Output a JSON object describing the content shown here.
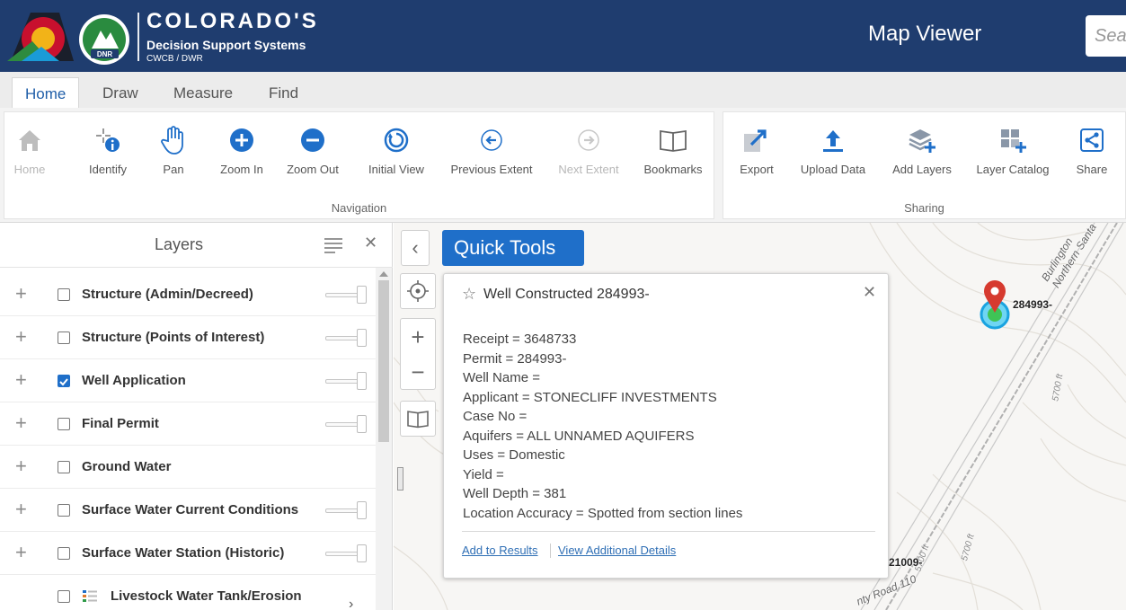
{
  "header": {
    "brand_title": "COLORADO'S",
    "brand_subtitle": "Decision Support Systems",
    "brand_org": "CWCB / DWR",
    "dnr_badge": "DNR",
    "app_title": "Map Viewer",
    "search_placeholder": "Sear",
    "colors": {
      "bar": "#1f3d6f",
      "accent": "#1f6fc9"
    }
  },
  "tabs": [
    {
      "label": "Home",
      "active": true
    },
    {
      "label": "Draw",
      "active": false
    },
    {
      "label": "Measure",
      "active": false
    },
    {
      "label": "Find",
      "active": false
    }
  ],
  "navigation": {
    "group_label": "Navigation",
    "tools": [
      {
        "label": "Home",
        "icon": "home-icon",
        "disabled": true
      },
      {
        "label": "Identify",
        "icon": "identify-icon",
        "disabled": false
      },
      {
        "label": "Pan",
        "icon": "hand-icon",
        "disabled": false
      },
      {
        "label": "Zoom In",
        "icon": "zoom-in-icon",
        "disabled": false
      },
      {
        "label": "Zoom Out",
        "icon": "zoom-out-icon",
        "disabled": false
      },
      {
        "label": "Initial View",
        "icon": "reset-icon",
        "disabled": false
      },
      {
        "label": "Previous Extent",
        "icon": "back-arrow-icon",
        "disabled": false
      },
      {
        "label": "Next Extent",
        "icon": "forward-arrow-icon",
        "disabled": true
      },
      {
        "label": "Bookmarks",
        "icon": "book-icon",
        "disabled": false
      }
    ]
  },
  "sharing": {
    "group_label": "Sharing",
    "tools": [
      {
        "label": "Export",
        "icon": "export-icon"
      },
      {
        "label": "Upload Data",
        "icon": "upload-icon"
      },
      {
        "label": "Add Layers",
        "icon": "layers-add-icon"
      },
      {
        "label": "Layer Catalog",
        "icon": "catalog-icon"
      },
      {
        "label": "Share",
        "icon": "share-icon"
      }
    ]
  },
  "layers": {
    "title": "Layers",
    "items": [
      {
        "name": "Structure (Admin/Decreed)",
        "checked": false
      },
      {
        "name": "Structure (Points of Interest)",
        "checked": false
      },
      {
        "name": "Well Application",
        "checked": true
      },
      {
        "name": "Final Permit",
        "checked": false
      },
      {
        "name": "Ground Water",
        "checked": false
      },
      {
        "name": "Surface Water Current Conditions",
        "checked": false
      },
      {
        "name": "Surface Water Station (Historic)",
        "checked": false
      },
      {
        "name": "Livestock Water Tank/Erosion",
        "checked": false
      }
    ]
  },
  "map": {
    "quick_tools_label": "Quick Tools",
    "popup": {
      "title": "Well Constructed 284993-",
      "attributes": [
        "Receipt = 3648733",
        "Permit = 284993-",
        "Well Name =",
        "Applicant = STONECLIFF INVESTMENTS",
        "Case No =",
        "Aquifers = ALL UNNAMED AQUIFERS",
        "Uses = Domestic",
        "Yield =",
        "Well Depth = 381",
        "Location Accuracy = Spotted from section lines"
      ],
      "add_link": "Add to Results",
      "details_link": "View Additional Details"
    },
    "labels": {
      "well_id": "284993-",
      "road_label": "Burlington Northern Santa",
      "contour_a": "5700 ft",
      "contour_b": "5700 ft",
      "contour_c": "5700 ft",
      "well_id_2": "21009-",
      "county_road": "nty Road 110"
    }
  }
}
